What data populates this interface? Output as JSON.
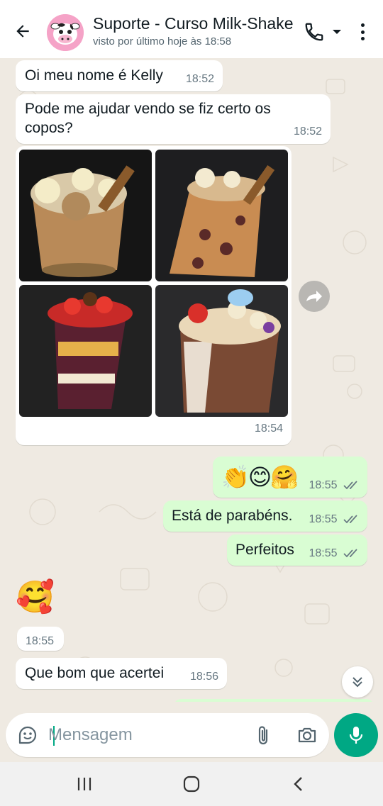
{
  "header": {
    "title": "Suporte - Curso Milk-Shake",
    "subtitle": "visto por último hoje às 18:58"
  },
  "messages": [
    {
      "dir": "in",
      "text": "Oi meu nome é Kelly",
      "time": "18:52"
    },
    {
      "dir": "in",
      "text": "Pode me ajudar vendo se fiz certo os copos?",
      "time": "18:52"
    },
    {
      "dir": "in",
      "type": "album",
      "time": "18:54"
    },
    {
      "dir": "out",
      "text": "👏😊🤗",
      "time": "18:55"
    },
    {
      "dir": "out",
      "text": "Está de parabéns.",
      "time": "18:55"
    },
    {
      "dir": "out",
      "text": "Perfeitos",
      "time": "18:55"
    },
    {
      "dir": "in",
      "text": "🥰",
      "time": "18:55"
    },
    {
      "dir": "in",
      "text": "Que bom que acertei",
      "time": "18:56"
    }
  ],
  "composer": {
    "placeholder": "Mensagem"
  },
  "colors": {
    "header_bg": "#ffffff",
    "chat_bg": "#efeae2",
    "outgoing_bubble": "#d9fdd3",
    "incoming_bubble": "#ffffff",
    "accent": "#00a884"
  },
  "icons": {
    "back": "arrow-left-icon",
    "call": "phone-icon",
    "menu": "more-vertical-icon",
    "forward": "forward-icon",
    "scroll": "double-chevron-down-icon",
    "sticker": "sticker-icon",
    "attach": "paperclip-icon",
    "camera": "camera-icon",
    "mic": "microphone-icon"
  }
}
